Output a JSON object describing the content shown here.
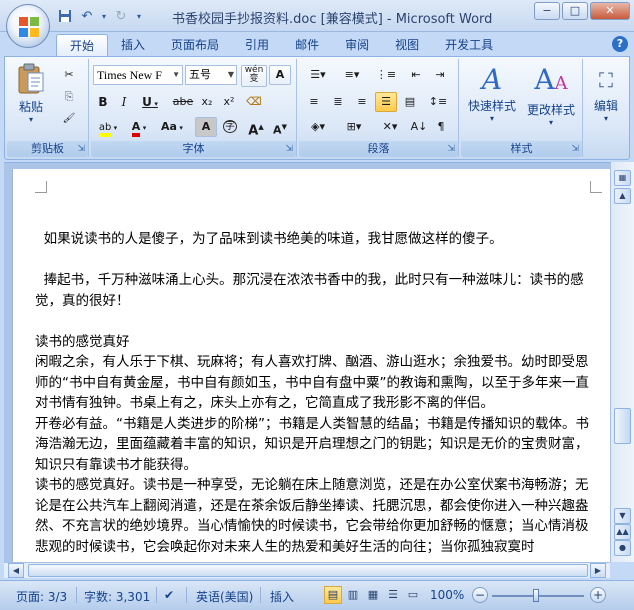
{
  "window": {
    "title": "书香校园手抄报资料.doc [兼容模式] - Microsoft Word",
    "minimize": "−",
    "maximize": "□",
    "close": "✕"
  },
  "qat": {
    "save_icon": "save-icon",
    "undo_icon": "undo-icon",
    "redo_icon": "redo-icon"
  },
  "tabs": [
    {
      "label": "开始",
      "active": true
    },
    {
      "label": "插入"
    },
    {
      "label": "页面布局"
    },
    {
      "label": "引用"
    },
    {
      "label": "邮件"
    },
    {
      "label": "审阅"
    },
    {
      "label": "视图"
    },
    {
      "label": "开发工具"
    }
  ],
  "ribbon": {
    "clipboard": {
      "label": "剪贴板",
      "paste": "粘贴",
      "cut": "✂",
      "copy": "⎘",
      "format_painter": "🖌"
    },
    "font": {
      "label": "字体",
      "font_name": "Times New F",
      "font_size": "五号",
      "bold": "B",
      "italic": "I",
      "underline": "U",
      "strike": "abe",
      "subscript": "x₂",
      "superscript": "x²",
      "change_case": "Aa",
      "grow": "A",
      "shrink": "A",
      "wen": "wén",
      "a_box": "A",
      "highlight": "ab",
      "font_color": "A",
      "char_shade": "A",
      "enclose": "字"
    },
    "paragraph": {
      "label": "段落"
    },
    "styles": {
      "label": "样式",
      "quick_styles": "快速样式",
      "change_styles": "更改样式"
    },
    "editing": {
      "label": "编辑"
    }
  },
  "document": {
    "paragraphs": [
      "  如果说读书的人是傻子，为了品味到读书绝美的味道，我甘愿做这样的傻子。",
      "",
      "  捧起书，千万种滋味涌上心头。那沉浸在浓浓书香中的我，此时只有一种滋味儿：读书的感觉，真的很好！",
      "",
      "读书的感觉真好",
      "闲暇之余，有人乐于下棋、玩麻将；有人喜欢打牌、酗酒、游山逛水；余独爱书。幼时即受恩师的“书中自有黄金屋，书中自有颜如玉，书中自有盘中粟”的教诲和熏陶，以至于多年来一直对书情有独钟。书桌上有之，床头上亦有之，它简直成了我形影不离的伴侣。",
      "开卷必有益。“书籍是人类进步的阶梯”；书籍是人类智慧的结晶；书籍是传播知识的载体。书海浩瀚无边，里面蕴藏着丰富的知识，知识是开启理想之门的钥匙；知识是无价的宝贵财富，知识只有靠读书才能获得。",
      "读书的感觉真好。读书是一种享受，无论躺在床上随意浏览，还是在办公室伏案书海畅游；无论是在公共汽车上翻阅消遣，还是在茶余饭后静坐捧读、托腮沉思，都会使你进入一种兴趣盎然、不充言状的绝妙境界。当心情愉快的时候读书，它会带给你更加舒畅的惬意；当心情消极悲观的时候读书，它会唤起你对未来人生的热爱和美好生活的向往；当你孤独寂寞时"
    ]
  },
  "status": {
    "page": "页面: 3/3",
    "words": "字数: 3,301",
    "language": "英语(美国)",
    "mode": "插入",
    "zoom": "100%"
  }
}
